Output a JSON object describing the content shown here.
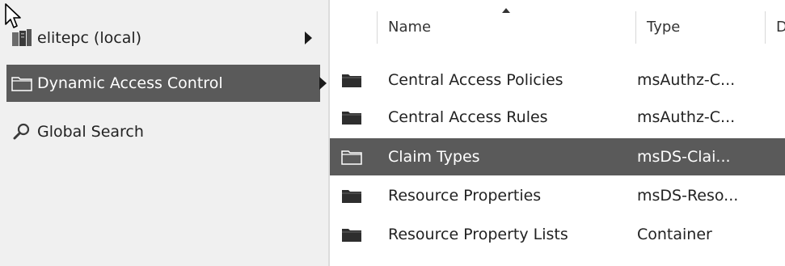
{
  "nav": {
    "items": [
      {
        "label": "elitepc (local)",
        "icon": "server-icon",
        "has_arrow": true,
        "selected": false
      },
      {
        "label": "Dynamic Access Control",
        "icon": "folder-icon",
        "has_arrow": true,
        "selected": true
      },
      {
        "label": "Global Search",
        "icon": "search-icon",
        "has_arrow": false,
        "selected": false
      }
    ]
  },
  "list": {
    "columns": {
      "name": "Name",
      "type": "Type",
      "third": "D"
    },
    "rows": [
      {
        "name": "Central Access Policies",
        "type": "msAuthz-C...",
        "selected": false
      },
      {
        "name": "Central Access Rules",
        "type": "msAuthz-C...",
        "selected": false
      },
      {
        "name": "Claim Types",
        "type": "msDS-Clai...",
        "selected": true
      },
      {
        "name": "Resource Properties",
        "type": "msDS-Reso...",
        "selected": false
      },
      {
        "name": "Resource Property Lists",
        "type": "Container",
        "selected": false
      }
    ]
  },
  "colors": {
    "selection": "#5a5a5a",
    "nav_background": "#f0f0f0"
  }
}
